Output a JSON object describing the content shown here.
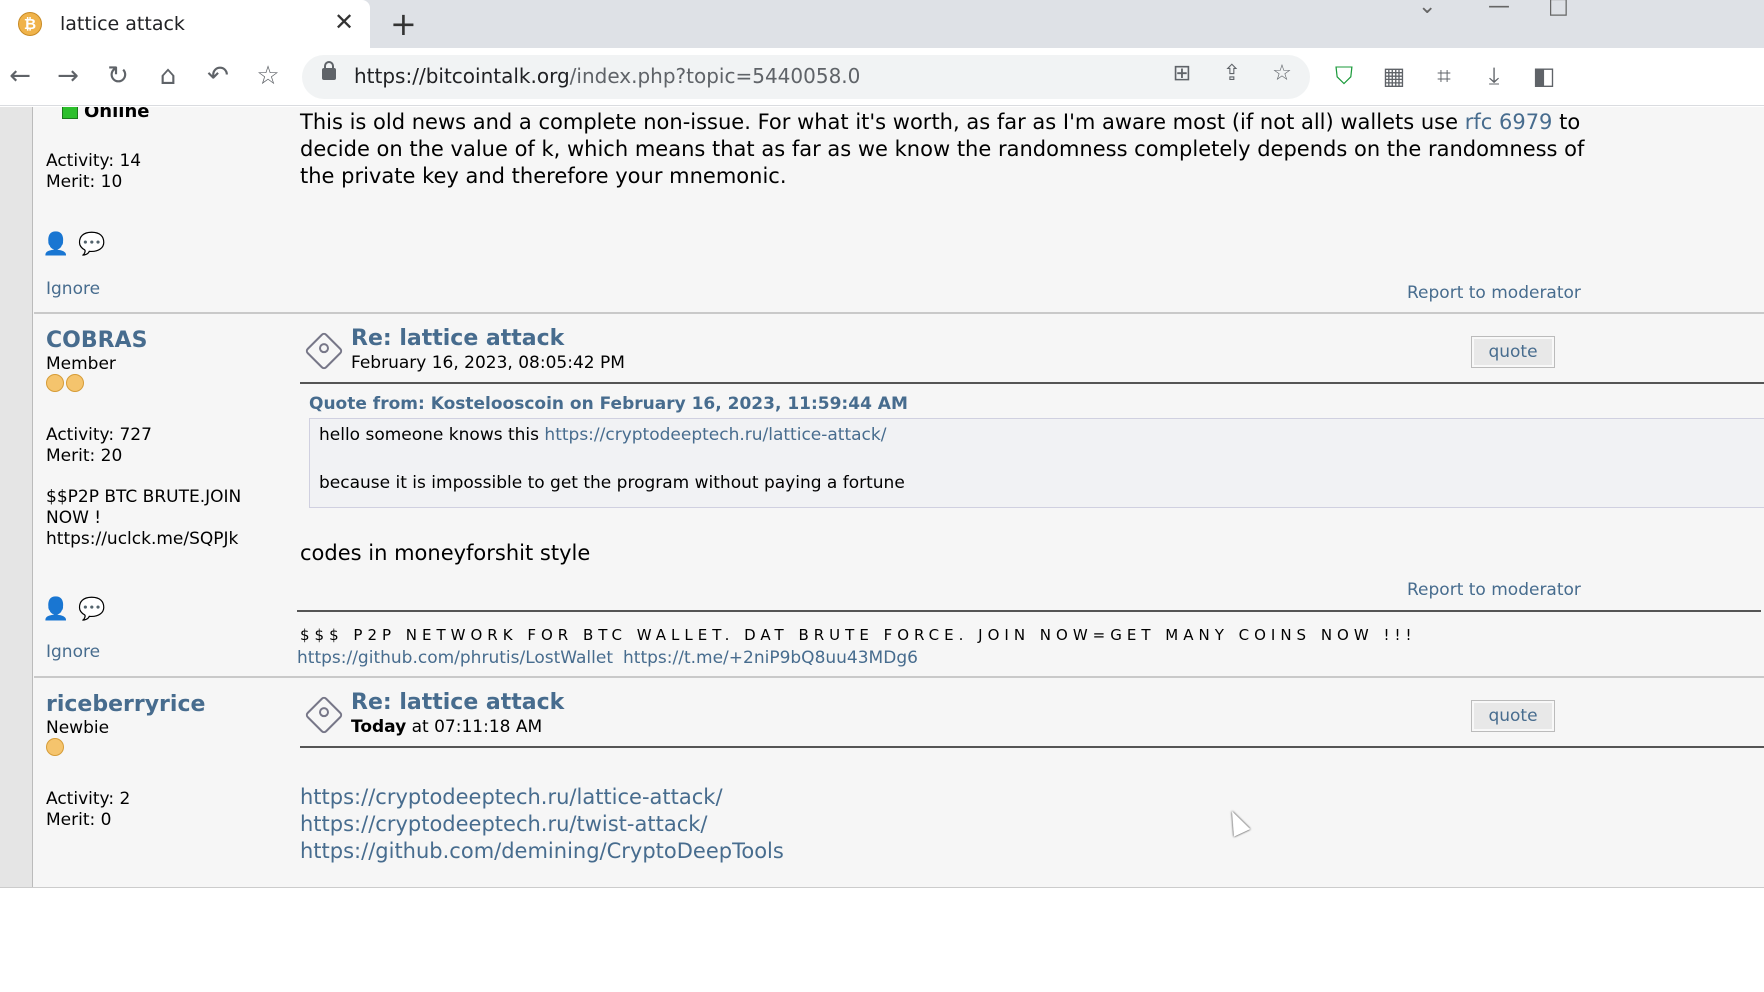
{
  "tab": {
    "title": "lattice attack",
    "favicon_glyph": "₿",
    "close": "✕",
    "new_tab": "+"
  },
  "window": {
    "chevron": "⌄",
    "minimize": "—",
    "maximize": "□"
  },
  "nav": {
    "back": "←",
    "forward": "→",
    "reload": "↻",
    "home": "⌂",
    "undo": "↶",
    "bookmark": "☆"
  },
  "address": {
    "host": "https://bitcointalk.org",
    "path": "/index.php?topic=5440058.0"
  },
  "omnibox_icons": {
    "translate": "⊞",
    "share": "⇪",
    "star": "☆"
  },
  "extensions": {
    "shield": "⛉",
    "grid": "▦",
    "crop": "⌗",
    "download": "⤓",
    "sidepanel": "◧"
  },
  "posts": [
    {
      "status": "Online",
      "activity": "Activity: 14",
      "merit": "Merit: 10",
      "body_pre": "This is old news and a complete non-issue. For what it's worth, as far as I'm aware most (if not all) wallets use ",
      "body_link": "rfc 6979",
      "body_post": " to decide on the value of k, which means that as far as we know the randomness completely depends on the randomness of the private key and therefore your mnemonic.",
      "ignore": "Ignore",
      "report": "Report to moderator"
    },
    {
      "username": "COBRAS",
      "rank": "Member",
      "activity": "Activity: 727",
      "merit": "Merit: 20",
      "personal_text": "$$P2P BTC BRUTE.JOIN NOW ! https://uclck.me/SQPJk",
      "subject": "Re: lattice attack",
      "date": "February 16, 2023, 08:05:42 PM",
      "quote_btn": "quote",
      "quote_header": "Quote from: Kostelooscoin on February 16, 2023, 11:59:44 AM",
      "quote_pre": "hello someone knows this ",
      "quote_link": "https://cryptodeeptech.ru/lattice-attack/",
      "quote_line2": "because it is impossible to get the program without paying a fortune",
      "body": "codes in moneyforshit style",
      "report": "Report to moderator",
      "ignore": "Ignore",
      "signature": "$$$ P2P NETWORK FOR BTC WALLET. DAT BRUTE FORCE. JOIN NOW=GET MANY COINS NOW !!!",
      "sig_link1": "https://github.com/phrutis/LostWallet",
      "sig_link2": "https://t.me/+2niP9bQ8uu43MDg6"
    },
    {
      "username": "riceberryrice",
      "rank": "Newbie",
      "activity": "Activity: 2",
      "merit": "Merit: 0",
      "subject": "Re: lattice attack",
      "date_bold": "Today",
      "date_rest": " at 07:11:18 AM",
      "quote_btn": "quote",
      "links": [
        "https://cryptodeeptech.ru/lattice-attack/",
        "https://cryptodeeptech.ru/twist-attack/",
        "https://github.com/demining/CryptoDeepTools"
      ]
    }
  ],
  "profile_icons": {
    "profile": "👤",
    "message": "💬"
  }
}
